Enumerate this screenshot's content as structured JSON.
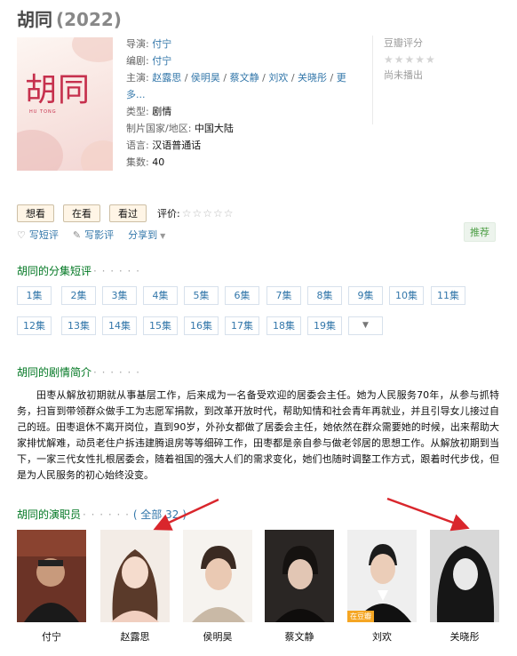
{
  "header": {
    "title": "胡同",
    "year": "(2022)"
  },
  "poster": {
    "title": "胡同",
    "subtitle": "HU TONG"
  },
  "info": {
    "director_label": "导演:",
    "director": "付宁",
    "writer_label": "编剧:",
    "writer": "付宁",
    "cast_label": "主演:",
    "cast": [
      "赵露思",
      "侯明昊",
      "蔡文静",
      "刘欢",
      "关晓彤"
    ],
    "cast_sep": " / ",
    "more_line1": "更",
    "more_line2": "多...",
    "genre_label": "类型:",
    "genre": "剧情",
    "region_label": "制片国家/地区:",
    "region": "中国大陆",
    "language_label": "语言:",
    "language": "汉语普通话",
    "episodes_label": "集数:",
    "episodes": "40"
  },
  "rating": {
    "label": "豆瓣评分",
    "stars": "★★★★★",
    "status": "尚未播出"
  },
  "actions": {
    "want": "想看",
    "watching": "在看",
    "watched": "看过",
    "eval_label": "评价:",
    "eval_stars": "☆☆☆☆☆"
  },
  "share": {
    "short_review": "写短评",
    "long_review": "写影评",
    "share_to": "分享到",
    "recommend": "推荐"
  },
  "episodes_section": {
    "title": "胡同的分集短评",
    "dots": "· · · · · ·",
    "items": [
      "1集",
      "2集",
      "3集",
      "4集",
      "5集",
      "6集",
      "7集",
      "8集",
      "9集",
      "10集",
      "11集",
      "12集",
      "13集",
      "14集",
      "15集",
      "16集",
      "17集",
      "18集",
      "19集"
    ]
  },
  "summary_section": {
    "title": "胡同的剧情简介",
    "dots": "· · · · · ·",
    "text": "田枣从解放初期就从事基层工作，后来成为一名备受欢迎的居委会主任。她为人民服务70年，从参与抓特务，扫盲到带领群众做手工为志愿军捐款，到改革开放时代，帮助知情和社会青年再就业，并且引导女儿接过自己的班。田枣退休不离开岗位，直到90岁，外孙女都做了居委会主任，她依然在群众需要她的时候，出来帮助大家排忧解难，动员老住户拆违建腾退房等等细碎工作，田枣都是亲自参与做老邻居的思想工作。从解放初期到当下，一家三代女性扎根居委会，随着祖国的强大人们的需求变化，她们也随时调整工作方式，跟着时代步伐，但是为人民服务的初心始终没变。"
  },
  "cast_section": {
    "title": "胡同的演职员",
    "dots": "· · · · · ·",
    "all_link": "( 全部 32 )",
    "people": [
      {
        "name": "付宁"
      },
      {
        "name": "赵露思"
      },
      {
        "name": "侯明昊"
      },
      {
        "name": "蔡文静"
      },
      {
        "name": "刘欢",
        "badge": "在豆瓣"
      },
      {
        "name": "关晓彤"
      }
    ]
  },
  "colors": {
    "link": "#3377aa",
    "section_green": "#007722",
    "poster_red": "#c6304d",
    "arrow_red": "#d9262c",
    "button_bg": "#fff5e6"
  }
}
